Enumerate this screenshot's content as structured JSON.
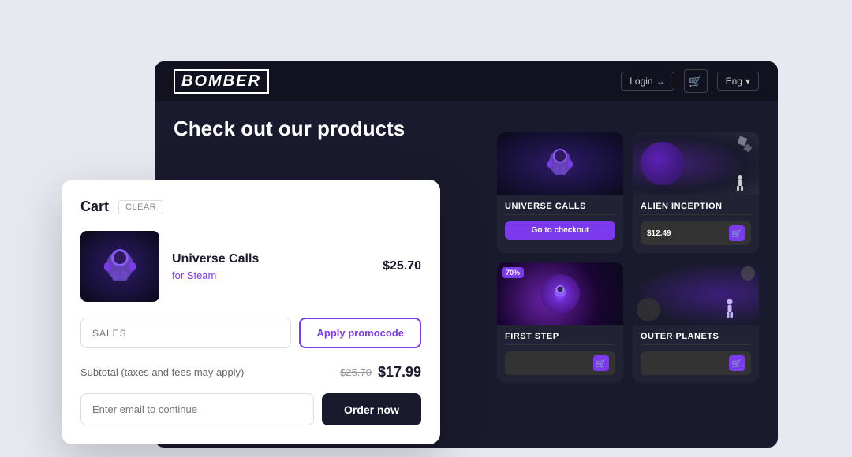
{
  "header": {
    "logo": "BOMBER",
    "login_label": "Login",
    "cart_icon": "🛒",
    "lang": "Eng"
  },
  "page": {
    "title": "Check out our products"
  },
  "products": [
    {
      "id": "universe-calls",
      "title": "UNIVERSE CALLS",
      "action": "Go to checkout",
      "type": "checkout"
    },
    {
      "id": "alien-inception",
      "title": "ALIEN INCEPTION",
      "price": "$12.49",
      "type": "price"
    },
    {
      "id": "first-step",
      "title": "FIRST STEP",
      "discount": "70%",
      "type": "price"
    },
    {
      "id": "outer-planets",
      "title": "OUTER PLANETS",
      "type": "price"
    }
  ],
  "cart": {
    "title": "Cart",
    "clear_label": "CLEAR",
    "item": {
      "name": "Universe Calls",
      "platform": "for Steam",
      "price": "$25.70"
    },
    "promo": {
      "placeholder": "SALES",
      "apply_label": "Apply promocode"
    },
    "subtotal": {
      "label": "Subtotal (taxes and fees may apply)",
      "original_price": "$25.70",
      "final_price": "$17.99"
    },
    "email_placeholder": "Enter email to continue",
    "order_label": "Order now"
  }
}
